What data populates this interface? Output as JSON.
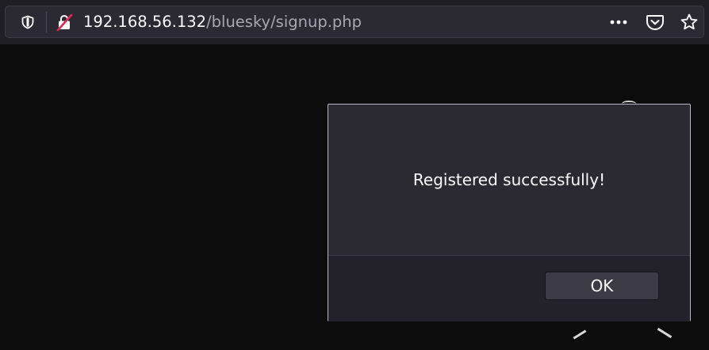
{
  "browser": {
    "url_host": "192.168.56.132",
    "url_path": "/bluesky/signup.php",
    "icons": {
      "tracking": "tracking-protection-shield-icon",
      "security": "insecure-lock-icon",
      "more": "page-actions-more-icon",
      "pocket": "pocket-icon",
      "bookmark": "bookmark-star-icon"
    }
  },
  "dialog": {
    "message": "Registered successfully!",
    "ok_label": "OK"
  },
  "colors": {
    "toolbar_bg": "#1f1e25",
    "urlbar_bg": "#2b2a33",
    "page_bg": "#0c0c0c",
    "dialog_bg": "#2b2a33",
    "insecure_accent": "#e22850",
    "text": "#fbfbfe",
    "muted_text": "#a8a7b0"
  }
}
